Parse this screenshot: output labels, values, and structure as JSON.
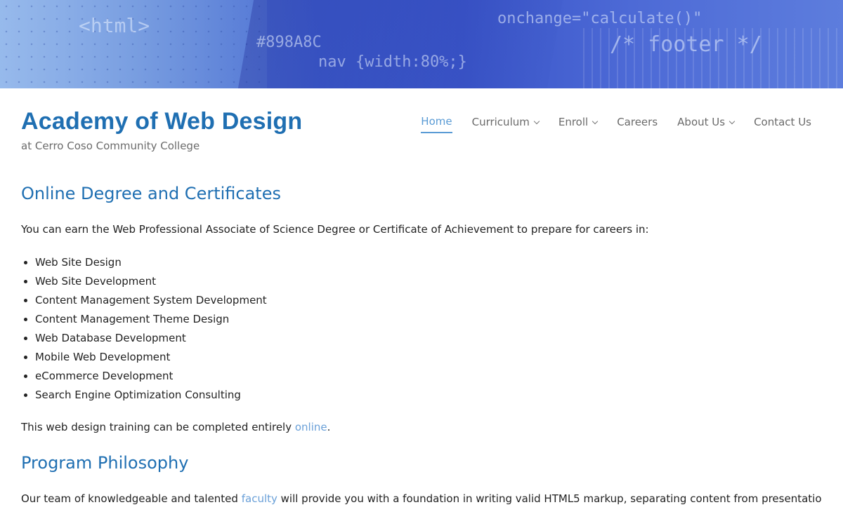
{
  "banner": {
    "code_fragments": [
      "<html>",
      "#898A8C",
      "nav {width:80%;}",
      "onchange=\"calculate()\"",
      "/* footer */"
    ]
  },
  "site": {
    "title": "Academy of Web Design",
    "tagline": "at Cerro Coso Community College"
  },
  "nav": {
    "items": [
      {
        "label": "Home",
        "active": true,
        "dropdown": false
      },
      {
        "label": "Curriculum",
        "active": false,
        "dropdown": true
      },
      {
        "label": "Enroll",
        "active": false,
        "dropdown": true
      },
      {
        "label": "Careers",
        "active": false,
        "dropdown": false
      },
      {
        "label": "About Us",
        "active": false,
        "dropdown": true
      },
      {
        "label": "Contact Us",
        "active": false,
        "dropdown": false
      }
    ]
  },
  "main": {
    "section1": {
      "heading": "Online Degree and Certificates",
      "intro": "You can earn the Web Professional Associate of Science Degree or Certificate of Achievement to prepare for careers in:",
      "careers": [
        "Web Site Design",
        "Web Site Development",
        "Content Management System Development",
        "Content Management Theme Design",
        "Web Database Development",
        "Mobile Web Development",
        "eCommerce Development",
        "Search Engine Optimization Consulting"
      ],
      "online_before": "This web design training can be completed entirely ",
      "online_link": "online",
      "online_after": "."
    },
    "section2": {
      "heading": "Program Philosophy",
      "p_before": "Our team of knowledgeable and talented ",
      "p_link": "faculty",
      "p_after": " will provide you with a foundation in writing valid HTML5 markup, separating content from presentation with CSS,"
    }
  },
  "colors": {
    "title_blue": "#1f6fb2",
    "link_blue": "#6aa0d8",
    "nav_active": "#5a9bd5"
  }
}
